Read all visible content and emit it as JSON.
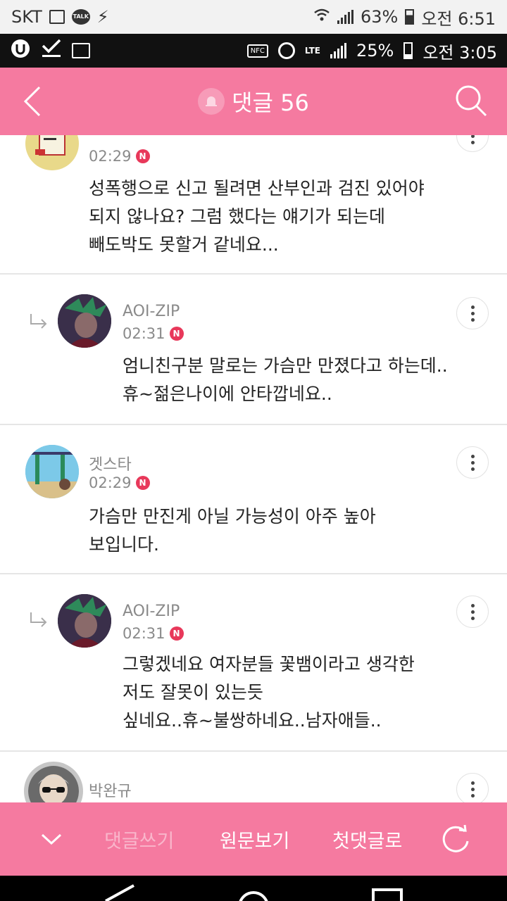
{
  "status_outer": {
    "carrier": "SKT",
    "talk_badge": "TALK",
    "battery": "63%",
    "time": "오전 6:51"
  },
  "status_inner": {
    "nfc": "NFC",
    "lte": "LTE",
    "battery": "25%",
    "time": "오전 3:05"
  },
  "header": {
    "title": "댓글 56"
  },
  "comments": [
    {
      "time": "02:29",
      "new_badge": "N",
      "body": [
        "성폭행으로 신고 될려면 산부인과 검진 있어야",
        "되지 않나요? 그럼 했다는 얘기가 되는데",
        "빼도박도 못할거 같네요..."
      ]
    },
    {
      "name": "AOI-ZIP",
      "time": "02:31",
      "new_badge": "N",
      "body": [
        "엄니친구분 말로는 가슴만 만졌다고 하는데..",
        "휴~젊은나이에 안타깝네요.."
      ]
    },
    {
      "name": "겟스타",
      "time": "02:29",
      "new_badge": "N",
      "body": [
        "가슴만 만진게 아닐 가능성이 아주 높아",
        "보입니다."
      ]
    },
    {
      "name": "AOI-ZIP",
      "time": "02:31",
      "new_badge": "N",
      "body": [
        "그렇겠네요 여자분들 꽃뱀이라고 생각한",
        "저도 잘못이 있는듯",
        "싶네요..휴~불쌍하네요..남자애들.."
      ]
    },
    {
      "name": "박완규"
    }
  ],
  "toolbar": {
    "write": "댓글쓰기",
    "view_original": "원문보기",
    "first_comment": "첫댓글로"
  },
  "colors": {
    "brand_pink": "#f57aa0",
    "new_badge": "#e8385a"
  }
}
